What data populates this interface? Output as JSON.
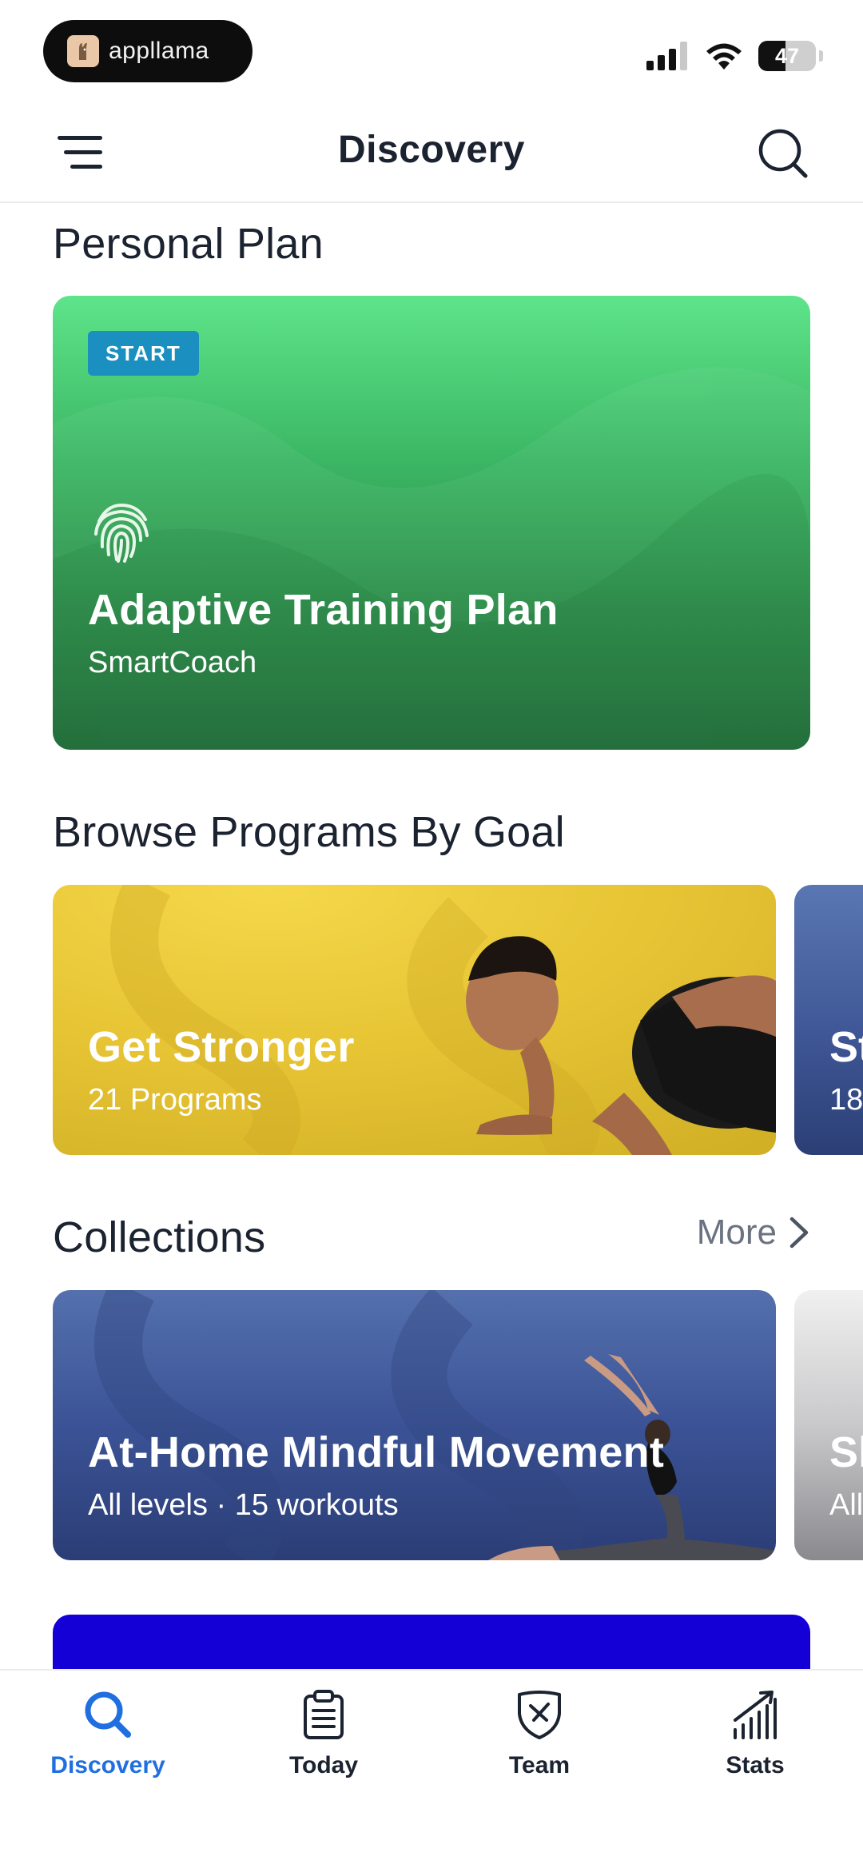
{
  "status_bar": {
    "app_name": "appllama",
    "battery_level": "47"
  },
  "header": {
    "title": "Discovery"
  },
  "personal_plan": {
    "section_title": "Personal Plan",
    "badge": "START",
    "title": "Adaptive Training Plan",
    "subtitle": "SmartCoach",
    "color": "#3cb865"
  },
  "programs_by_goal": {
    "section_title": "Browse Programs By Goal",
    "cards": [
      {
        "title": "Get Stronger",
        "subtitle": "21 Programs"
      },
      {
        "title": "St",
        "subtitle": "18"
      }
    ]
  },
  "collections": {
    "section_title": "Collections",
    "more_label": "More",
    "cards": [
      {
        "title": "At-Home Mindful Movement",
        "subtitle": "All levels · 15 workouts"
      },
      {
        "title": "Sl",
        "subtitle": "All"
      }
    ]
  },
  "tab_bar": {
    "active_color": "#1f6fe0",
    "tabs": [
      {
        "label": "Discovery",
        "icon": "search-icon"
      },
      {
        "label": "Today",
        "icon": "clipboard-icon"
      },
      {
        "label": "Team",
        "icon": "team-shield-icon"
      },
      {
        "label": "Stats",
        "icon": "stats-icon"
      }
    ]
  }
}
